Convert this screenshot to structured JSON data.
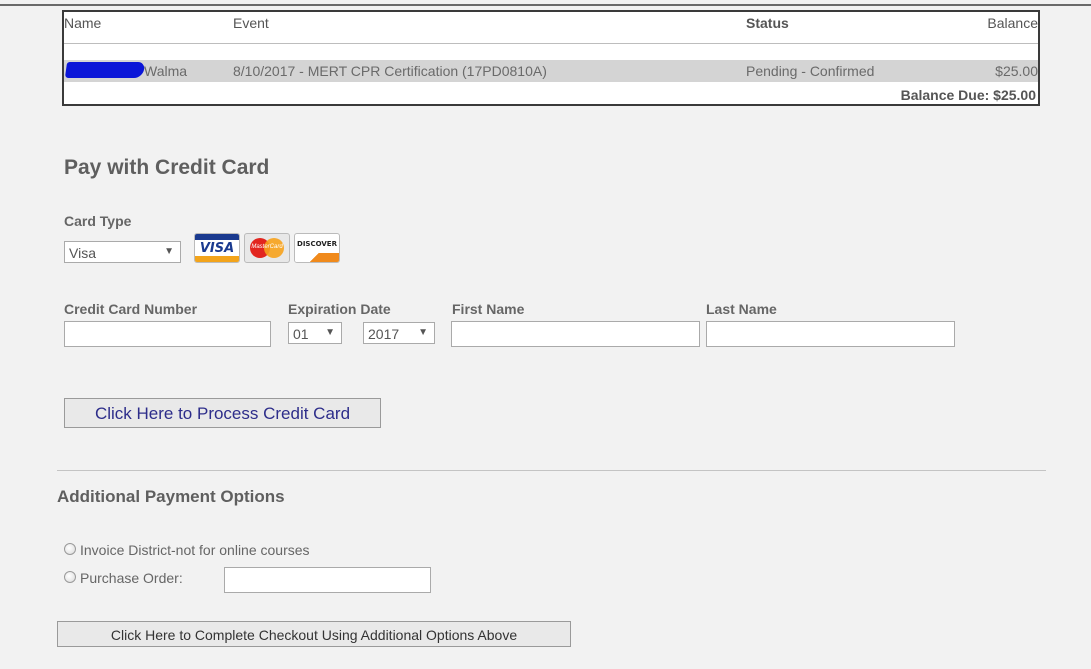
{
  "table": {
    "headers": {
      "name": "Name",
      "event": "Event",
      "status": "Status",
      "balance": "Balance"
    },
    "rows": [
      {
        "name_visible": "Walma",
        "event": "8/10/2017 - MERT CPR Certification (17PD0810A)",
        "status": "Pending - Confirmed",
        "balance": "$25.00"
      }
    ],
    "balance_due": "Balance Due: $25.00"
  },
  "credit_card": {
    "title": "Pay with Credit Card",
    "card_type_label": "Card Type",
    "card_type_value": "Visa",
    "card_logos": [
      "visa-logo",
      "mastercard-logo",
      "discover-logo"
    ],
    "visa_text": "VISA",
    "mastercard_text": "MasterCard",
    "discover_text": "DISCOVER",
    "card_number_label": "Credit Card Number",
    "card_number_value": "",
    "expiration_label": "Expiration Date",
    "exp_month": "01",
    "exp_year": "2017",
    "first_name_label": "First Name",
    "first_name_value": "",
    "last_name_label": "Last Name",
    "last_name_value": "",
    "process_button": "Click Here to Process Credit Card"
  },
  "additional": {
    "title": "Additional Payment Options",
    "invoice_label": "Invoice District-not for online courses",
    "po_label": "Purchase Order:",
    "po_value": "",
    "complete_button": "Click Here to Complete Checkout Using Additional Options Above"
  },
  "colors": {
    "background": "#f2f2f2",
    "row_highlight": "#d4d4d4",
    "redaction": "#0a15d8",
    "button_text": "#2d2d8a"
  }
}
